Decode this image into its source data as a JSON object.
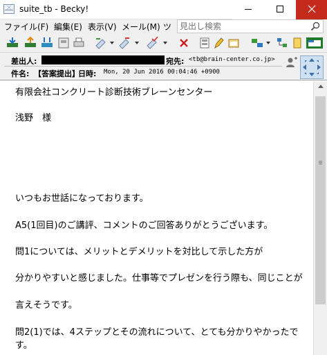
{
  "window": {
    "title": "suite_tb - Becky!"
  },
  "menu": {
    "items": [
      {
        "label": "ファイル(F)"
      },
      {
        "label": "編集(E)"
      },
      {
        "label": "表示(V)"
      },
      {
        "label": "メール(M)"
      },
      {
        "label": "ツ"
      }
    ]
  },
  "search": {
    "placeholder": "見出し検索",
    "icon": "search-icon"
  },
  "toolbar": {
    "icons": [
      "receive-mail-icon",
      "send-mail-icon",
      "send-receive-icon",
      "address-book-icon",
      "print-icon",
      "reply-icon",
      "forward-icon",
      "check-icon",
      "delete-icon",
      "filter-icon",
      "pencil-icon",
      "folder-icon",
      "tools-icon",
      "tree-icon",
      "clipboard-icon",
      "app-window-icon"
    ]
  },
  "header": {
    "from_label": "差出人:",
    "to_label": "宛先:",
    "to_value": "<tb@brain-center.co.jp>",
    "subject_label": "件名:",
    "subject_value": "【答案提出】",
    "date_label": "日時:",
    "date_value": "Mon, 20 Jun 2016 00:04:46 +0900"
  },
  "body": {
    "lines": [
      "有限会社コンクリート診断技術ブレーンセンター",
      "浅野　様",
      "いつもお世話になっております。",
      "A5(1回目)のご講評、コメントのご回答ありがとうございます。",
      "問1については、メリットとデメリットを対比して示した方が",
      "分かりやすいと感じました。仕事等でプレゼンを行う際も、同じことが",
      "言えそうです。",
      "問2(1)では、4ステップとその流れについて、とても分かりやかったで",
      "す。"
    ]
  },
  "colors": {
    "close_button": "#c42b1c",
    "chrome": "#f0f0f0"
  }
}
